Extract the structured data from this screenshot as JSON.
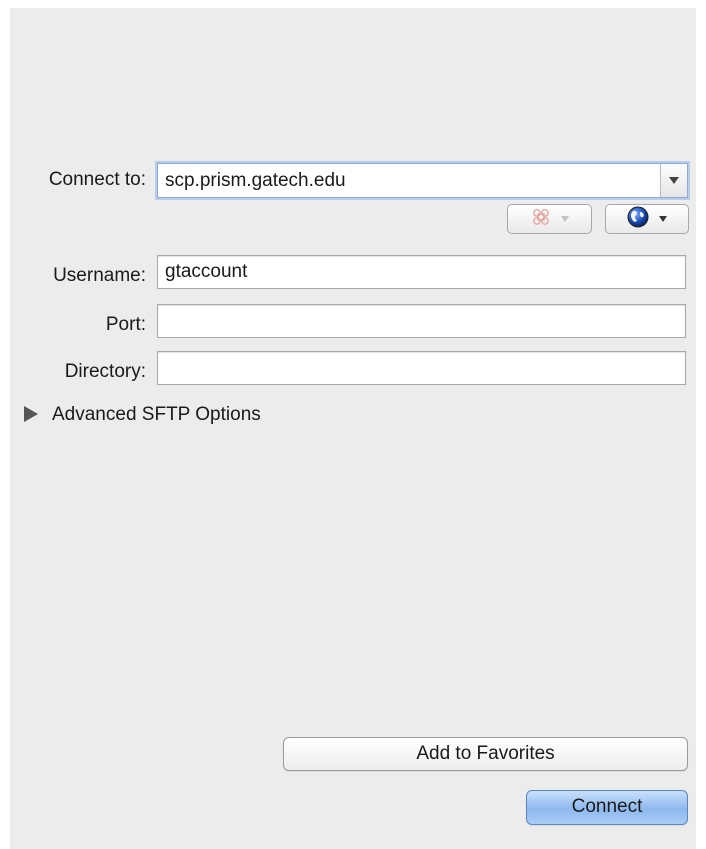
{
  "connection": {
    "connect_to_label": "Connect to:",
    "connect_to_value": "scp.prism.gatech.edu",
    "username_label": "Username:",
    "username_value": "gtaccount",
    "port_label": "Port:",
    "port_value": "",
    "directory_label": "Directory:",
    "directory_value": ""
  },
  "toolbar": {
    "bookmark_icon": "cloverleaf-icon",
    "globe_icon": "globe-icon"
  },
  "advanced": {
    "label": "Advanced SFTP Options",
    "expanded": false
  },
  "actions": {
    "add_favorites_label": "Add to Favorites",
    "connect_label": "Connect"
  },
  "colors": {
    "panel_bg": "#ececec",
    "focus_ring": "#b7cdeb",
    "default_button": "#8db8ee"
  }
}
